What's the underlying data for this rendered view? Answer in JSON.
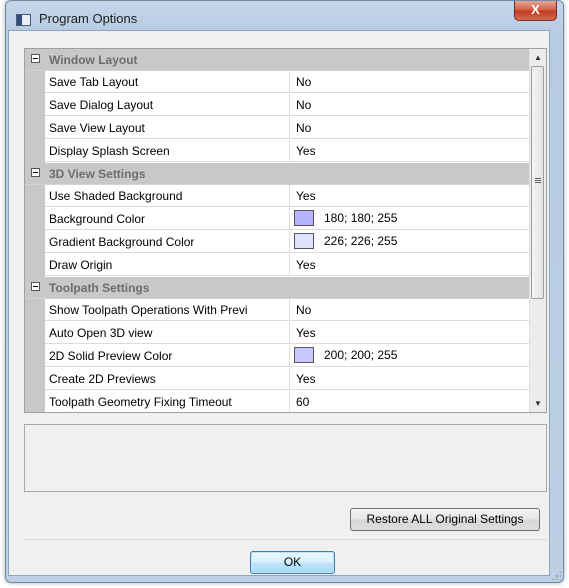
{
  "window": {
    "title": "Program Options",
    "close_glyph": "X"
  },
  "grid": {
    "categories": [
      {
        "label": "Window Layout",
        "rows": [
          {
            "name": "Save Tab Layout",
            "value": "No"
          },
          {
            "name": "Save Dialog Layout",
            "value": "No"
          },
          {
            "name": "Save View Layout",
            "value": "No"
          },
          {
            "name": "Display Splash Screen",
            "value": "Yes"
          }
        ]
      },
      {
        "label": "3D View Settings",
        "rows": [
          {
            "name": "Use Shaded Background",
            "value": "Yes"
          },
          {
            "name": "Background Color",
            "value": "180; 180; 255",
            "swatch": "#b4b4ff"
          },
          {
            "name": "Gradient Background Color",
            "value": "226; 226; 255",
            "swatch": "#e2e2ff"
          },
          {
            "name": "Draw Origin",
            "value": "Yes"
          }
        ]
      },
      {
        "label": "Toolpath Settings",
        "rows": [
          {
            "name": "Show Toolpath Operations With Previ",
            "value": "No"
          },
          {
            "name": "Auto Open 3D view",
            "value": "Yes"
          },
          {
            "name": "2D Solid Preview Color",
            "value": "200; 200; 255",
            "swatch": "#c8c8ff"
          },
          {
            "name": "Create 2D Previews",
            "value": "Yes"
          },
          {
            "name": "Toolpath Geometry Fixing Timeout",
            "value": "60"
          }
        ]
      }
    ]
  },
  "scrollbar": {
    "up_glyph": "▲",
    "down_glyph": "▼"
  },
  "buttons": {
    "restore_label": "Restore ALL Original Settings",
    "ok_label": "OK"
  },
  "colors": {
    "category_band": "#c8c8c8",
    "category_text": "#6d6d6d",
    "ok_accent": "#3c7fb1",
    "close_red": "#c0391f"
  }
}
